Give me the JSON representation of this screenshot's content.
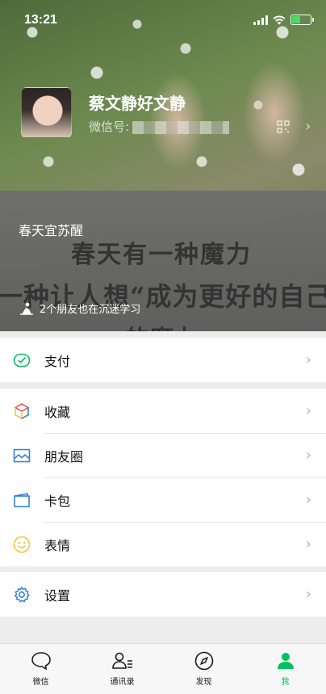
{
  "status_bar": {
    "time": "13:21",
    "battery_level": 0.45
  },
  "profile": {
    "name": "蔡文静好文静",
    "wechat_id_label": "微信号:",
    "wechat_id_value": ""
  },
  "status_card": {
    "title": "春天宜苏醒",
    "background_lines": [
      "春天有一种魔力",
      "一种让人想“成为更好的自己",
      "的魔力"
    ],
    "friends_text": "2个朋友也在沉迷学习"
  },
  "menu": {
    "pay": "支付",
    "favorites": "收藏",
    "moments": "朋友圈",
    "cards": "卡包",
    "stickers": "表情",
    "settings": "设置"
  },
  "tabs": [
    {
      "label": "微信",
      "icon": "chat-icon"
    },
    {
      "label": "通讯录",
      "icon": "contacts-icon"
    },
    {
      "label": "发现",
      "icon": "compass-icon"
    },
    {
      "label": "我",
      "icon": "me-icon"
    }
  ],
  "colors": {
    "accent": "#07c160",
    "pay_icon": "#07c160",
    "settings_icon": "#2b7bd6",
    "cards_icon": "#2b7bd6",
    "stickers_icon": "#f5c22b"
  }
}
